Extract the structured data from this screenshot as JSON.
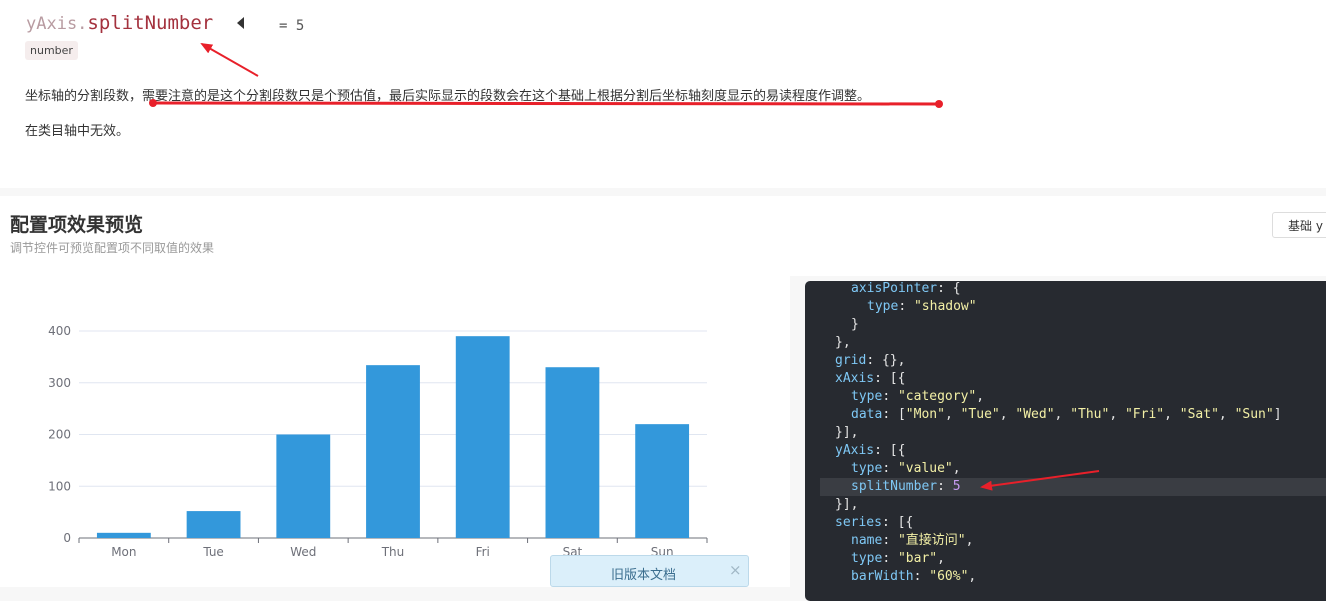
{
  "doc": {
    "parent": "yAxis.",
    "name": "splitNumber",
    "default_value": "= 5",
    "type_badge": "number",
    "description": "坐标轴的分割段数，需要注意的是这个分割段数只是个预估值，最后实际显示的段数会在这个基础上根据分割后坐标轴刻度显示的易读程度作调整。",
    "note": "在类目轴中无效。"
  },
  "preview": {
    "title": "配置项效果预览",
    "subtitle": "调节控件可预览配置项不同取值的效果",
    "button_label": "基础 y 轴"
  },
  "chart_data": {
    "type": "bar",
    "categories": [
      "Mon",
      "Tue",
      "Wed",
      "Thu",
      "Fri",
      "Sat",
      "Sun"
    ],
    "values": [
      10,
      52,
      200,
      334,
      390,
      330,
      220
    ],
    "ylim": [
      0,
      400
    ],
    "yticks": [
      0,
      100,
      200,
      300,
      400
    ],
    "bar_color": "#3398db",
    "grid": true
  },
  "code_lines": [
    {
      "indent": 3,
      "tokens": [
        [
          "k",
          "axisPointer"
        ],
        [
          "p",
          ": {"
        ]
      ]
    },
    {
      "indent": 4,
      "tokens": [
        [
          "k",
          "type"
        ],
        [
          "p",
          ": "
        ],
        [
          "s",
          "\"shadow\""
        ]
      ]
    },
    {
      "indent": 3,
      "tokens": [
        [
          "p",
          "}"
        ]
      ]
    },
    {
      "indent": 2,
      "tokens": [
        [
          "p",
          "},"
        ]
      ]
    },
    {
      "indent": 2,
      "tokens": [
        [
          "k",
          "grid"
        ],
        [
          "p",
          ": {},"
        ]
      ]
    },
    {
      "indent": 2,
      "tokens": [
        [
          "k",
          "xAxis"
        ],
        [
          "p",
          ": [{"
        ]
      ]
    },
    {
      "indent": 3,
      "tokens": [
        [
          "k",
          "type"
        ],
        [
          "p",
          ": "
        ],
        [
          "s",
          "\"category\""
        ],
        [
          "p",
          ","
        ]
      ]
    },
    {
      "indent": 3,
      "tokens": [
        [
          "k",
          "data"
        ],
        [
          "p",
          ": ["
        ],
        [
          "s",
          "\"Mon\""
        ],
        [
          "p",
          ", "
        ],
        [
          "s",
          "\"Tue\""
        ],
        [
          "p",
          ", "
        ],
        [
          "s",
          "\"Wed\""
        ],
        [
          "p",
          ", "
        ],
        [
          "s",
          "\"Thu\""
        ],
        [
          "p",
          ", "
        ],
        [
          "s",
          "\"Fri\""
        ],
        [
          "p",
          ", "
        ],
        [
          "s",
          "\"Sat\""
        ],
        [
          "p",
          ", "
        ],
        [
          "s",
          "\"Sun\""
        ],
        [
          "p",
          "]"
        ]
      ]
    },
    {
      "indent": 2,
      "tokens": [
        [
          "p",
          "}],"
        ]
      ]
    },
    {
      "indent": 2,
      "tokens": [
        [
          "k",
          "yAxis"
        ],
        [
          "p",
          ": [{"
        ]
      ]
    },
    {
      "indent": 3,
      "tokens": [
        [
          "k",
          "type"
        ],
        [
          "p",
          ": "
        ],
        [
          "s",
          "\"value\""
        ],
        [
          "p",
          ","
        ]
      ]
    },
    {
      "indent": 3,
      "tokens": [
        [
          "k",
          "splitNumber"
        ],
        [
          "p",
          ": "
        ],
        [
          "n",
          "5"
        ]
      ],
      "highlight": true
    },
    {
      "indent": 2,
      "tokens": [
        [
          "p",
          "}],"
        ]
      ]
    },
    {
      "indent": 2,
      "tokens": [
        [
          "k",
          "series"
        ],
        [
          "p",
          ": [{"
        ]
      ]
    },
    {
      "indent": 3,
      "tokens": [
        [
          "k",
          "name"
        ],
        [
          "p",
          ": "
        ],
        [
          "s",
          "\"直接访问\""
        ],
        [
          "p",
          ","
        ]
      ]
    },
    {
      "indent": 3,
      "tokens": [
        [
          "k",
          "type"
        ],
        [
          "p",
          ": "
        ],
        [
          "s",
          "\"bar\""
        ],
        [
          "p",
          ","
        ]
      ]
    },
    {
      "indent": 3,
      "tokens": [
        [
          "k",
          "barWidth"
        ],
        [
          "p",
          ": "
        ],
        [
          "s",
          "\"60%\""
        ],
        [
          "p",
          ","
        ]
      ]
    }
  ],
  "toast": {
    "label": "旧版本文档",
    "close": "×"
  },
  "colors": {
    "annotation": "#e8202a",
    "accent_prop": "#a4323e"
  }
}
